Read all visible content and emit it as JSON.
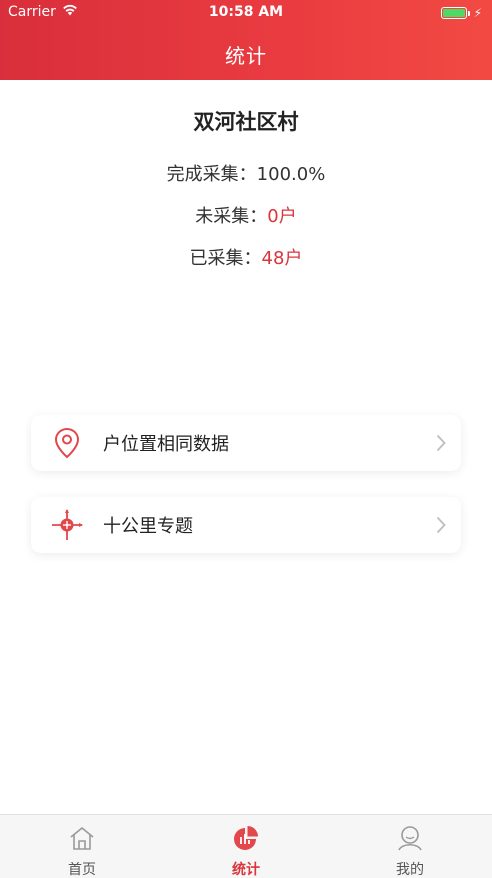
{
  "status_bar": {
    "carrier": "Carrier",
    "time": "10:58 AM"
  },
  "header": {
    "title": "统计"
  },
  "summary": {
    "village_name": "双河社区村",
    "completed_label": "完成采集：",
    "completed_value": "100.0%",
    "uncollected_label": "未采集：",
    "uncollected_value": "0户",
    "collected_label": "已采集：",
    "collected_value": "48户"
  },
  "menu": [
    {
      "label": "户位置相同数据",
      "icon": "location-pin-icon"
    },
    {
      "label": "十公里专题",
      "icon": "crosshair-target-icon"
    }
  ],
  "tabbar": {
    "items": [
      {
        "label": "首页",
        "icon": "home-icon",
        "active": false
      },
      {
        "label": "统计",
        "icon": "pie-chart-icon",
        "active": true
      },
      {
        "label": "我的",
        "icon": "user-icon",
        "active": false
      }
    ]
  },
  "colors": {
    "accent": "#d9353c",
    "header_start": "#d92f3c",
    "header_end": "#f24a43",
    "battery_fill": "#4cd964"
  }
}
